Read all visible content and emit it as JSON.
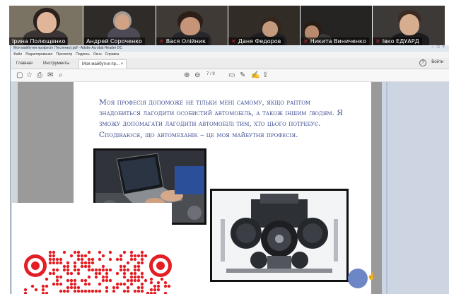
{
  "participants": [
    {
      "name": "Ірина Полющенко",
      "muted": false,
      "active": true,
      "bg": "#7a7262",
      "face": "#e0b59a",
      "hair": "#2a211d",
      "shirt": "#3b3434"
    },
    {
      "name": "Андрей Сорoченко",
      "muted": false,
      "active": false,
      "bg": "#2e2b28",
      "face": "#d2a286",
      "hair": "#a09a92",
      "shirt": "#4d4a56"
    },
    {
      "name": "Вася Олійник",
      "muted": true,
      "active": false,
      "bg": "#3f3a36",
      "face": "#c59479",
      "hair": "#2b1f18",
      "shirt": "#27262b"
    },
    {
      "name": "Даня Федоров",
      "muted": true,
      "active": false,
      "bg": "#322c27",
      "face": "#c49a7e",
      "hair": "#34261c",
      "shirt": "#1f1f22"
    },
    {
      "name": "Никита Виниченко",
      "muted": true,
      "active": false,
      "bg": "#262423",
      "face": "#b98a6e",
      "hair": "#2a1d16",
      "shirt": "#3a3a3a"
    },
    {
      "name": "Івко ЕДУАРД",
      "muted": true,
      "active": false,
      "bg": "#3d3937",
      "face": "#d7ad90",
      "hair": "#3b2a22",
      "shirt": "#1c1c1e"
    }
  ],
  "acrobat": {
    "window_title": "Моя майбутня професія (Тесленко).pdf - Adobe Acrobat Reader DC",
    "menu": [
      "Файл",
      "Редактирование",
      "Просмотр",
      "Подпись",
      "Окно",
      "Справка"
    ],
    "tabs": {
      "home": "Главная",
      "tools": "Инструменты",
      "document": "Моя майбутня пр..."
    },
    "signin": "Войти",
    "page_current": "7",
    "page_total": "/ 9"
  },
  "document": {
    "text": "Моя професія допоможе не тільки мені самому, якщо раптом знадобиться лагодити особистий автомобіль, а також іншим людям. Я зможу допомагати лагодити автомобілі тим, хто цього потребує. Сподіваюся, що автомеханік – це моя майбутня професія."
  },
  "icons": [
    "page-icon",
    "star-icon",
    "print-icon",
    "mail-icon",
    "zoom-icon",
    "arrow-up-icon",
    "arrow-down-icon",
    "comment-icon",
    "pen-icon",
    "sign-icon",
    "share-icon",
    "help-icon",
    "microphone-muted-icon",
    "hand-cursor-icon"
  ],
  "colors": {
    "doc_text": "#3d4c92",
    "qr_red": "#e31e24",
    "cursor_dot": "#6d86c5",
    "active_speaker": "#9bd13d"
  }
}
